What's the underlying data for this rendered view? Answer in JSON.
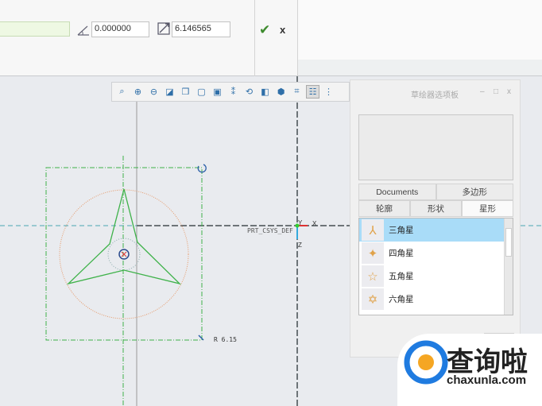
{
  "dashboard": {
    "angle_value": "0.000000",
    "scale_value": "6.146565",
    "ok_label": "✔",
    "cancel_label": "x"
  },
  "toolbar": {
    "icons": [
      "refit-icon",
      "zoom-in-icon",
      "zoom-out-icon",
      "repaint-icon",
      "display-style-icon",
      "saved-views-icon",
      "view-manager-icon",
      "datum-display-icon",
      "spin-center-icon",
      "annotation-display-icon",
      "3d-view-icon",
      "sketch-view-icon",
      "sketcher-display-icon",
      "more-icon"
    ]
  },
  "palette": {
    "title": "草绘器选项板",
    "tabs_row1": [
      "Documents",
      "多边形"
    ],
    "tabs_row2": [
      "轮廓",
      "形状",
      "星形"
    ],
    "active_tab": "星形",
    "items": [
      "三角星",
      "四角星",
      "五角星",
      "六角星"
    ],
    "selected_item": "三角星"
  },
  "canvas": {
    "csys_label": "PRT_CSYS_DEF",
    "axis_x": "X",
    "axis_y": "Y",
    "axis_z": "Z",
    "radius_label": "R 6.15"
  },
  "watermark": {
    "brand": "查询啦",
    "url": "chaxunla.com"
  },
  "colors": {
    "sketch_green": "#3fb24a",
    "circle_orange": "#e69a6a",
    "selection_blue": "#a9dcf8"
  }
}
